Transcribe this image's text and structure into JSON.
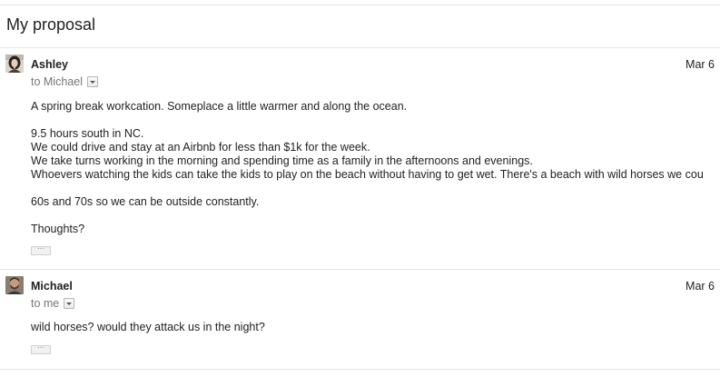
{
  "thread": {
    "subject": "My proposal"
  },
  "messages": [
    {
      "sender": "Ashley",
      "date": "Mar 6",
      "recipient": "to Michael",
      "avatar_icon": "user-photo-ashley",
      "body": [
        "A spring break workcation. Someplace a little warmer and along the ocean.",
        "",
        "9.5 hours south in NC.",
        "We could drive and stay at an Airbnb for less than $1k for the week.",
        "We take turns working in the morning and spending time as a family in the afternoons and evenings.",
        "Whoevers watching the kids can take the kids to play on the beach without having to get wet. There's a beach with wild horses we cou",
        "",
        "60s and 70s so we can be outside constantly.",
        "",
        "Thoughts?"
      ],
      "show_trimmed_label": "···"
    },
    {
      "sender": "Michael",
      "date": "Mar 6",
      "recipient": "to me",
      "avatar_icon": "user-photo-michael",
      "body": [
        "wild horses? would they attack us in the night?"
      ],
      "show_trimmed_label": "···"
    }
  ]
}
